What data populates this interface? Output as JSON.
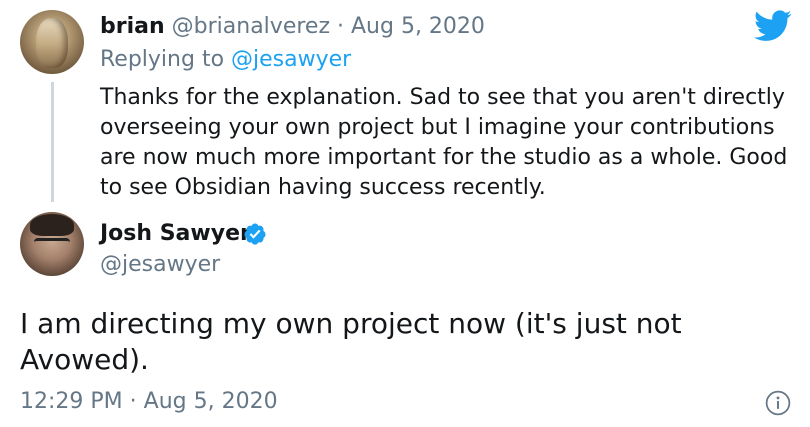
{
  "reply_tweet": {
    "display_name": "brian",
    "handle": "@brianalverez",
    "separator": "·",
    "date": "Aug 5, 2020",
    "replying_prefix": "Replying to",
    "replying_handle": "@jesawyer",
    "text": "Thanks for the explanation. Sad to see that you aren't directly overseeing your own project but I imagine your contributions are now much more important for the studio as a whole. Good to see Obsidian having success recently."
  },
  "main_tweet": {
    "display_name": "Josh Sawyer",
    "handle": "@jesawyer",
    "verified": true,
    "text": "I am directing my own project now (it's just not Avowed).",
    "time": "12:29 PM",
    "separator": "·",
    "date": "Aug 5, 2020"
  },
  "icons": {
    "brand": "twitter-bird-icon",
    "verified": "verified-badge-icon",
    "info": "info-icon"
  },
  "colors": {
    "brand_blue": "#1da1f2",
    "muted_text": "#657786",
    "primary_text": "#14171a",
    "thread_line": "#ccd6dd"
  }
}
